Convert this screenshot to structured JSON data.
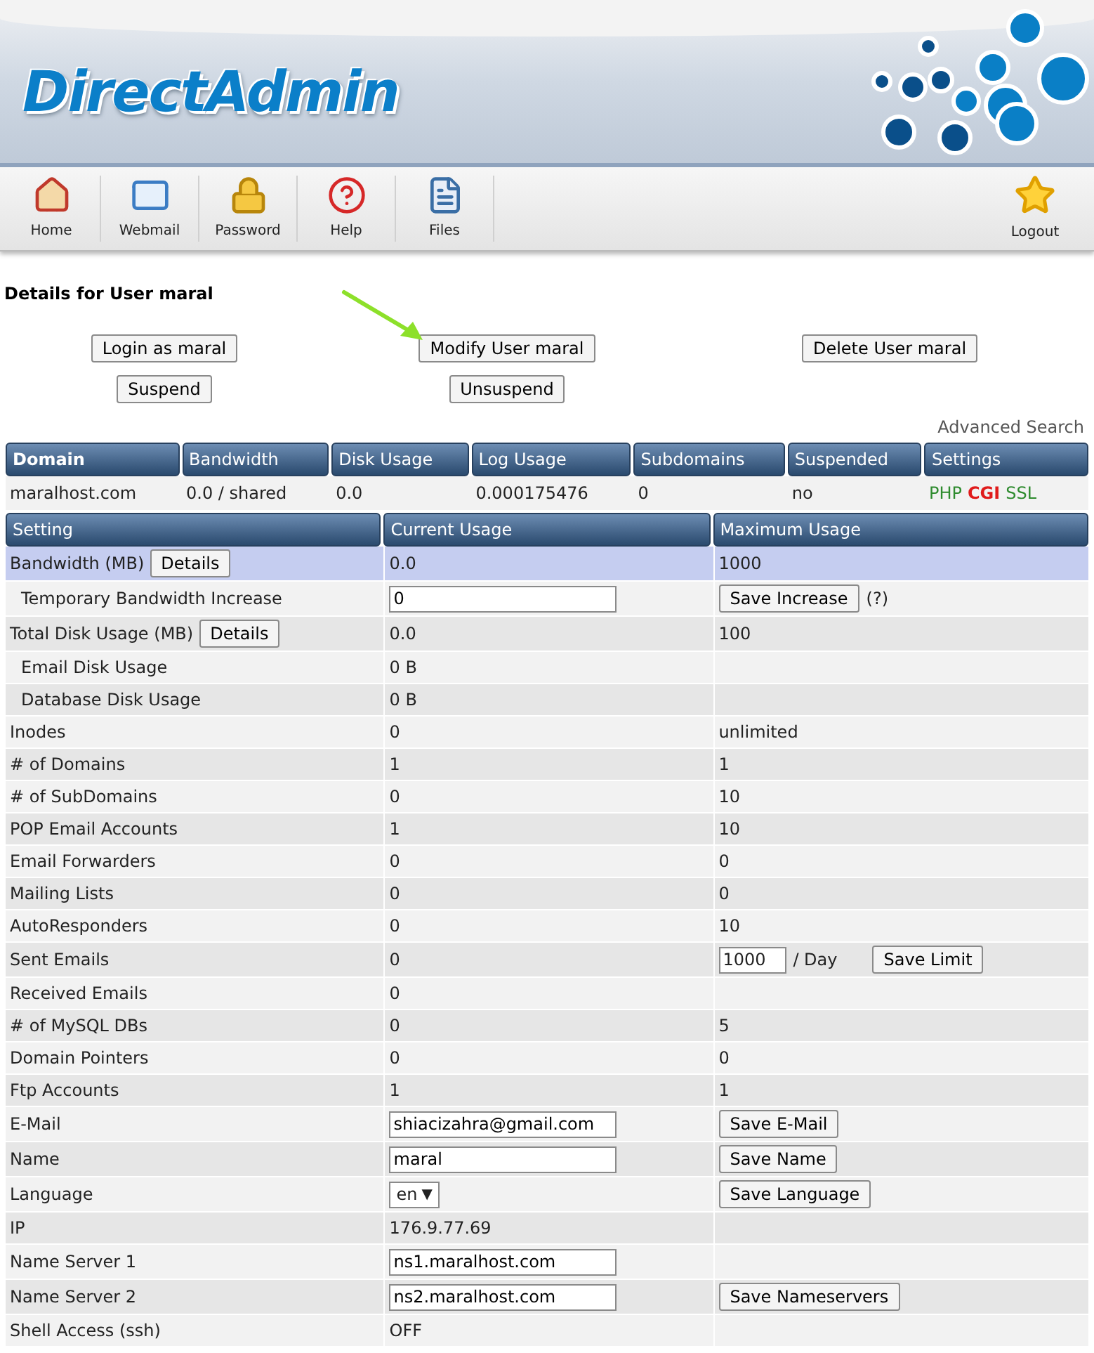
{
  "header": {
    "logo": "DirectAdmin"
  },
  "toolbar": [
    {
      "label": "Home"
    },
    {
      "label": "Webmail"
    },
    {
      "label": "Password"
    },
    {
      "label": "Help"
    },
    {
      "label": "Files"
    }
  ],
  "logout": {
    "label": "Logout"
  },
  "title": "Details for User maral",
  "actions": [
    [
      {
        "label": "Login as maral"
      },
      {
        "label": "Modify User maral"
      },
      {
        "label": "Delete User maral"
      }
    ],
    [
      {
        "label": "Suspend"
      },
      {
        "label": "Unsuspend"
      }
    ]
  ],
  "advanced_search": "Advanced Search",
  "domain_table": {
    "columns": [
      "Domain",
      "Bandwidth",
      "Disk Usage",
      "Log Usage",
      "Subdomains",
      "Suspended",
      "Settings"
    ],
    "row": {
      "domain": "maralhost.com",
      "bandwidth": "0.0 / shared",
      "disk_usage": "0.0",
      "log_usage": "0.000175476",
      "subdomains": "0",
      "suspended": "no",
      "settings": [
        {
          "label": "PHP",
          "color": "#2e8b2e"
        },
        {
          "label": "CGI",
          "color": "#e01b1b"
        },
        {
          "label": "SSL",
          "color": "#2e8b2e"
        }
      ]
    }
  },
  "usage_table": {
    "columns": [
      "Setting",
      "Current Usage",
      "Maximum Usage"
    ],
    "rows": [
      {
        "setting": "Bandwidth (MB)",
        "button": "Details",
        "selected": true,
        "current": {
          "kind": "text",
          "text": "0.0"
        },
        "maximum": {
          "kind": "text",
          "text": "1000"
        },
        "children": [
          {
            "setting": "Temporary Bandwidth Increase",
            "selected": false,
            "current": {
              "kind": "input",
              "value": "0"
            },
            "maximum": {
              "kind": "save",
              "button": "Save Increase",
              "note": "(?)"
            }
          }
        ]
      },
      {
        "setting": "Total Disk Usage (MB)",
        "button": "Details",
        "selected": false,
        "current": {
          "kind": "text",
          "text": "0.0"
        },
        "maximum": {
          "kind": "text",
          "text": "100"
        },
        "children": [
          {
            "setting": "Email Disk Usage",
            "selected": false,
            "current": {
              "kind": "text",
              "text": "0 B"
            },
            "maximum": {
              "kind": "empty"
            }
          },
          {
            "setting": "Database Disk Usage",
            "selected": false,
            "current": {
              "kind": "text",
              "text": "0 B"
            },
            "maximum": {
              "kind": "empty"
            }
          }
        ]
      },
      {
        "setting": "Inodes",
        "selected": false,
        "current": {
          "kind": "text",
          "text": "0"
        },
        "maximum": {
          "kind": "text",
          "text": "unlimited"
        }
      },
      {
        "setting": "# of Domains",
        "selected": false,
        "current": {
          "kind": "text",
          "text": "1"
        },
        "maximum": {
          "kind": "text",
          "text": "1"
        }
      },
      {
        "setting": "# of SubDomains",
        "selected": false,
        "current": {
          "kind": "text",
          "text": "0"
        },
        "maximum": {
          "kind": "text",
          "text": "10"
        }
      },
      {
        "setting": "POP Email Accounts",
        "selected": false,
        "current": {
          "kind": "text",
          "text": "1"
        },
        "maximum": {
          "kind": "text",
          "text": "10"
        }
      },
      {
        "setting": "Email Forwarders",
        "selected": false,
        "current": {
          "kind": "text",
          "text": "0"
        },
        "maximum": {
          "kind": "text",
          "text": "0"
        }
      },
      {
        "setting": "Mailing Lists",
        "selected": false,
        "current": {
          "kind": "text",
          "text": "0"
        },
        "maximum": {
          "kind": "text",
          "text": "0"
        }
      },
      {
        "setting": "AutoResponders",
        "selected": false,
        "current": {
          "kind": "text",
          "text": "0"
        },
        "maximum": {
          "kind": "text",
          "text": "10"
        }
      },
      {
        "setting": "Sent Emails",
        "selected": false,
        "current": {
          "kind": "text",
          "text": "0"
        },
        "maximum": {
          "kind": "limit",
          "value": "1000",
          "unit": "/ Day",
          "button": "Save Limit"
        }
      },
      {
        "setting": "Received Emails",
        "selected": false,
        "current": {
          "kind": "text",
          "text": "0"
        },
        "maximum": {
          "kind": "empty"
        }
      },
      {
        "setting": "# of MySQL DBs",
        "selected": false,
        "current": {
          "kind": "text",
          "text": "0"
        },
        "maximum": {
          "kind": "text",
          "text": "5"
        }
      },
      {
        "setting": "Domain Pointers",
        "selected": false,
        "current": {
          "kind": "text",
          "text": "0"
        },
        "maximum": {
          "kind": "text",
          "text": "0"
        }
      },
      {
        "setting": "Ftp Accounts",
        "selected": false,
        "current": {
          "kind": "text",
          "text": "1"
        },
        "maximum": {
          "kind": "text",
          "text": "1"
        }
      },
      {
        "setting": "E-Mail",
        "selected": false,
        "current": {
          "kind": "input",
          "value": "shiacizahra@gmail.com"
        },
        "maximum": {
          "kind": "save",
          "button": "Save E-Mail"
        }
      },
      {
        "setting": "Name",
        "selected": false,
        "current": {
          "kind": "input",
          "value": "maral"
        },
        "maximum": {
          "kind": "save",
          "button": "Save Name"
        }
      },
      {
        "setting": "Language",
        "selected": false,
        "current": {
          "kind": "select",
          "value": "en",
          "caret": "▼"
        },
        "maximum": {
          "kind": "save",
          "button": "Save Language"
        }
      },
      {
        "setting": "IP",
        "selected": false,
        "current": {
          "kind": "text",
          "text": "176.9.77.69"
        },
        "maximum": {
          "kind": "empty"
        }
      },
      {
        "setting": "Name Server 1",
        "selected": false,
        "current": {
          "kind": "input",
          "value": "ns1.maralhost.com"
        },
        "maximum": {
          "kind": "empty"
        }
      },
      {
        "setting": "Name Server 2",
        "selected": false,
        "current": {
          "kind": "input",
          "value": "ns2.maralhost.com"
        },
        "maximum": {
          "kind": "save",
          "button": "Save Nameservers"
        }
      },
      {
        "setting": "Shell Access (ssh)",
        "selected": false,
        "current": {
          "kind": "text",
          "text": "OFF"
        },
        "maximum": {
          "kind": "empty"
        }
      }
    ]
  }
}
